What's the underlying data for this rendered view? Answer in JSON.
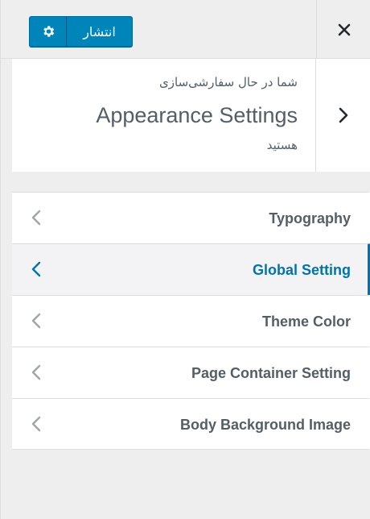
{
  "header": {
    "publish_label": "انتشار",
    "settings_icon": "gear-icon",
    "close_icon": "close-icon"
  },
  "info": {
    "prefix": "شما در حال سفارشی‌سازی",
    "title": "Appearance Settings",
    "suffix": "هستید",
    "back_icon": "chevron-right-icon"
  },
  "sections": [
    {
      "label": "Typography",
      "active": false
    },
    {
      "label": "Global Setting",
      "active": true
    },
    {
      "label": "Theme Color",
      "active": false
    },
    {
      "label": "Page Container Setting",
      "active": false
    },
    {
      "label": "Body Background Image",
      "active": false
    }
  ],
  "colors": {
    "accent": "#0073aa",
    "button": "#0085ba",
    "text": "#555d66",
    "chevron_inactive": "#a0a5aa"
  }
}
